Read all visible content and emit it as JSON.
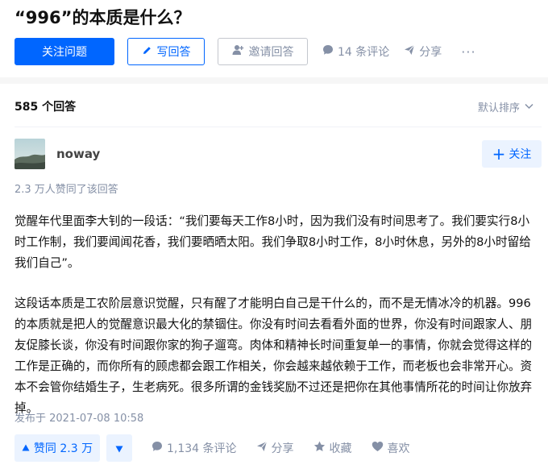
{
  "question": {
    "title": "“996”的本质是什么？"
  },
  "toolbar": {
    "follow_question": "关注问题",
    "write_answer": "写回答",
    "invite_answer": "邀请回答",
    "comments": "14 条评论",
    "share": "分享",
    "more": "···"
  },
  "answers_header": {
    "count": "585 个回答",
    "sort": "默认排序"
  },
  "answer": {
    "author_name": "noway",
    "follow_label": "关注",
    "vote_summary": "2.3 万人赞同了该回答",
    "paragraphs": [
      "觉醒年代里面李大钊的一段话：“我们要每天工作8小时，因为我们没有时间思考了。我们要实行8小时工作制，我们要闻闻花香，我们要晒晒太阳。我们争取8小时工作，8小时休息，另外的8小时留给我们自己”。",
      "这段话本质是工农阶层意识觉醒，只有醒了才能明白自己是干什么的，而不是无情冰冷的机器。996的本质就是把人的觉醒意识最大化的禁锢住。你没有时间去看看外面的世界，你没有时间跟家人、朋友促膝长谈，你没有时间跟你家的狗子遛弯。肉体和精神长时间重复单一的事情，你就会觉得这样的工作是正确的，而你所有的顾虑都会跟工作相关，你会越来越依赖于工作，而老板也会非常开心。资本不会管你结婚生子，生老病死。很多所谓的金钱奖励不过还是把你在其他事情所花的时间让你放弃掉。"
    ],
    "published": "发布于 2021-07-08 10:58",
    "vote_up": "赞同 2.3 万",
    "comments": "1,134 条评论",
    "share": "分享",
    "favorite": "收藏",
    "like": "喜欢"
  },
  "colors": {
    "brand": "#0066ff",
    "brand_light": "#ebf3ff",
    "muted": "#8590a6",
    "text": "#121212"
  },
  "icons": [
    "pencil-icon",
    "invite-user-icon",
    "comment-icon",
    "share-icon",
    "chevron-down-icon",
    "plus-icon",
    "triangle-up-icon",
    "triangle-down-icon",
    "star-icon",
    "heart-icon"
  ]
}
